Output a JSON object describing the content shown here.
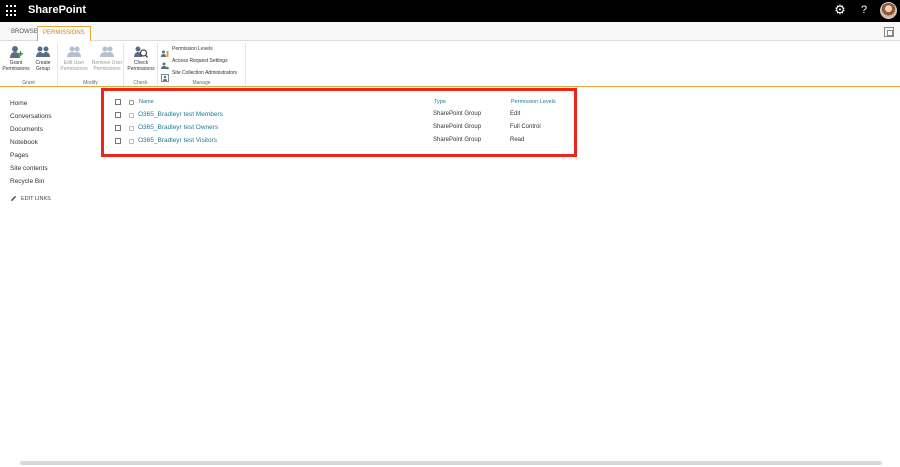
{
  "suitebar": {
    "app_title": "SharePoint",
    "gear_icon": "gear-icon",
    "help_label": "?"
  },
  "tabs": [
    {
      "label": "BROWSE"
    },
    {
      "label": "PERMISSIONS"
    }
  ],
  "ribbon": {
    "groups": {
      "grant": {
        "label": "Grant",
        "buttons": [
          {
            "line1": "Grant",
            "line2": "Permissions"
          },
          {
            "line1": "Create",
            "line2": "Group"
          }
        ]
      },
      "modify": {
        "label": "Modify",
        "buttons": [
          {
            "line1": "Edit User",
            "line2": "Permissions"
          },
          {
            "line1": "Remove User",
            "line2": "Permissions"
          }
        ]
      },
      "check": {
        "label": "Check",
        "buttons": [
          {
            "line1": "Check",
            "line2": "Permissions"
          }
        ]
      },
      "manage": {
        "label": "Manage",
        "items": [
          {
            "label": "Permission Levels"
          },
          {
            "label": "Access Request Settings"
          },
          {
            "label": "Site Collection Administrators"
          }
        ]
      }
    }
  },
  "leftnav": {
    "items": [
      {
        "label": "Home"
      },
      {
        "label": "Conversations"
      },
      {
        "label": "Documents"
      },
      {
        "label": "Notebook"
      },
      {
        "label": "Pages"
      },
      {
        "label": "Site contents"
      },
      {
        "label": "Recycle Bin"
      }
    ],
    "edit_links": "EDIT LINKS"
  },
  "list": {
    "headers": {
      "name": "Name",
      "type": "Type",
      "permission_levels": "Permission Levels"
    },
    "rows": [
      {
        "name": "O365_Bradleyr test Members",
        "type": "SharePoint Group",
        "level": "Edit"
      },
      {
        "name": "O365_Bradleyr test Owners",
        "type": "SharePoint Group",
        "level": "Full Control"
      },
      {
        "name": "O365_Bradleyr test Visitors",
        "type": "SharePoint Group",
        "level": "Read"
      }
    ]
  },
  "colors": {
    "suitebar": "#000000",
    "accent": "#e07b00",
    "link": "#1e7a9a",
    "highlight_border": "#e8261a"
  }
}
